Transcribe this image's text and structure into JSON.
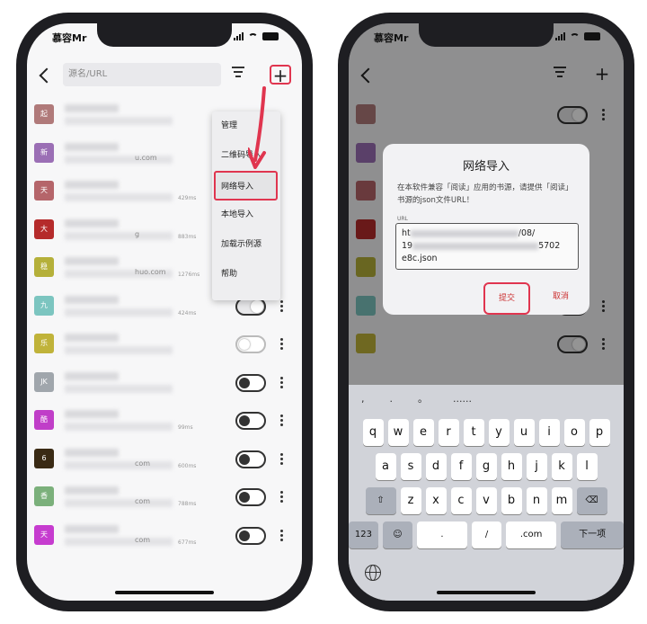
{
  "left_phone": {
    "status_time": "慕容Mr",
    "search_placeholder": "源名/URL",
    "menu_items": [
      "管理",
      "二维码导入",
      "网络导入",
      "本地导入",
      "加载示例源",
      "帮助"
    ],
    "sources": [
      {
        "initial": "起",
        "color": "#b07a7a",
        "suffix": "",
        "ms": "",
        "toggle": "none"
      },
      {
        "initial": "新",
        "color": "#9b6fb5",
        "suffix": "u.com",
        "ms": "",
        "toggle": "none"
      },
      {
        "initial": "天",
        "color": "#b5656a",
        "suffix": "",
        "ms": "429ms",
        "toggle": "none"
      },
      {
        "initial": "大",
        "color": "#b52b2b",
        "suffix": "g",
        "ms": "883ms",
        "toggle": "none"
      },
      {
        "initial": "稳",
        "color": "#b5b03a",
        "suffix": "huo.com",
        "ms": "1276ms",
        "toggle": "none"
      },
      {
        "initial": "九",
        "color": "#7cc5c0",
        "suffix": "",
        "ms": "424ms",
        "toggle": "on"
      },
      {
        "initial": "乐",
        "color": "#c0b33a",
        "suffix": "",
        "ms": "",
        "toggle": "dim"
      },
      {
        "initial": "JK",
        "color": "#a0a6ac",
        "suffix": "",
        "ms": "",
        "toggle": "off"
      },
      {
        "initial": "酷",
        "color": "#c03ec8",
        "suffix": "",
        "ms": "99ms",
        "toggle": "off"
      },
      {
        "initial": "6",
        "color": "#3a2a14",
        "suffix": "com",
        "ms": "600ms",
        "toggle": "off"
      },
      {
        "initial": "香",
        "color": "#7bb07b",
        "suffix": "com",
        "ms": "788ms",
        "toggle": "off"
      },
      {
        "initial": "天",
        "color": "#c63ccf",
        "suffix": "com",
        "ms": "677ms",
        "toggle": "off"
      }
    ]
  },
  "right_phone": {
    "status_time": "慕容Mr",
    "dialog": {
      "title": "网络导入",
      "message": "在本软件兼容「阅读」应用的书源，请提供「阅读」书源的json文件URL！",
      "url_label": "URL",
      "url_line1_start": "ht",
      "url_line1_end": "/08/",
      "url_line2_start": "19",
      "url_line2_end": "5702",
      "url_line3": "e8c.json",
      "submit": "提交",
      "cancel": "取消"
    },
    "keyboard": {
      "suggestions": [
        ",",
        ".",
        "。",
        "......"
      ],
      "row1": [
        "q",
        "w",
        "e",
        "r",
        "t",
        "y",
        "u",
        "i",
        "o",
        "p"
      ],
      "row2": [
        "a",
        "s",
        "d",
        "f",
        "g",
        "h",
        "j",
        "k",
        "l"
      ],
      "row3": [
        "z",
        "x",
        "c",
        "v",
        "b",
        "n",
        "m"
      ],
      "shift": "⇧",
      "delete": "⌫",
      "num": "123",
      "emoji": "☺",
      "period": ".",
      "slash": "/",
      "dotcom": ".com",
      "next": "下一项"
    }
  },
  "colors": {
    "highlight": "#e0354f"
  }
}
